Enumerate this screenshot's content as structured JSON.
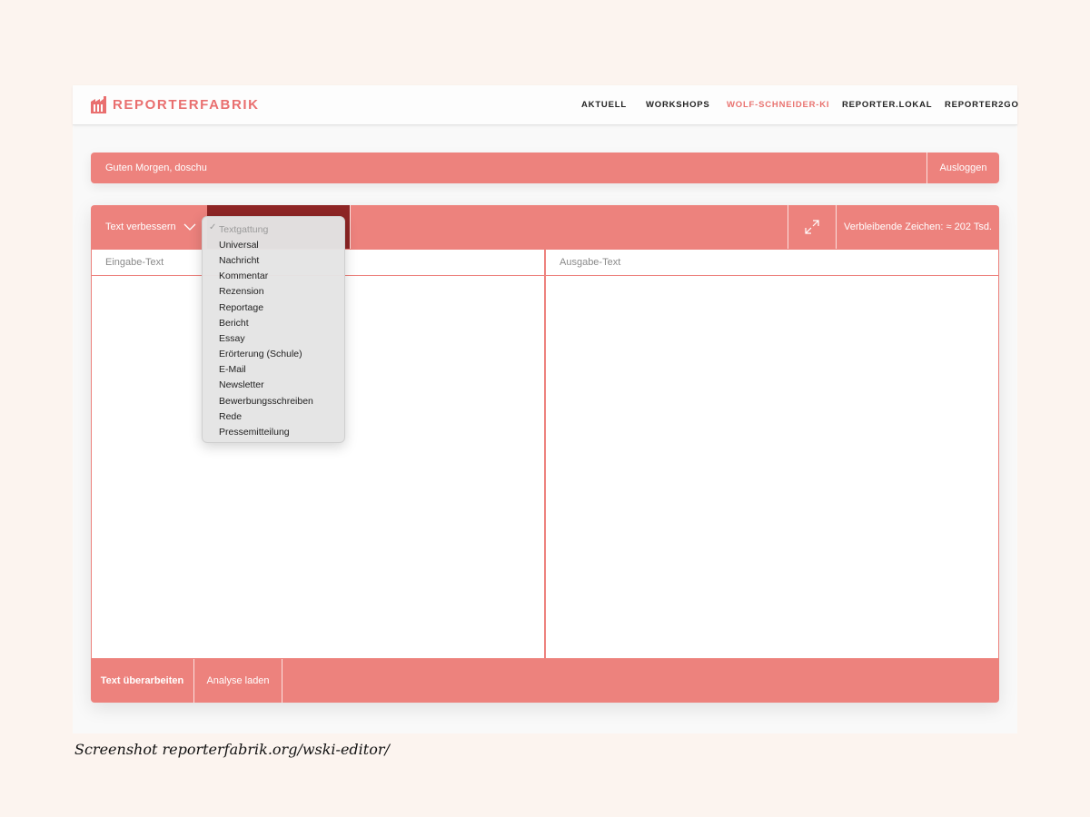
{
  "nav": {
    "logo_text": "REPORTERFABRIK",
    "links": [
      {
        "label": "AKTUELL"
      },
      {
        "label": "WORKSHOPS"
      },
      {
        "label": "WOLF-SCHNEIDER-KI",
        "active": true
      },
      {
        "label": "REPORTER.LOKAL"
      },
      {
        "label": "REPORTER2GO"
      }
    ]
  },
  "greeting_bar": {
    "greeting": "Guten Morgen, doschu",
    "logout_label": "Ausloggen"
  },
  "toolbar": {
    "mode_label": "Text verbessern",
    "char_count": "Verbleibende Zeichen: ≈ 202 Tsd."
  },
  "panes": {
    "input_header": "Eingabe-Text",
    "output_header": "Ausgabe-Text"
  },
  "bottom": {
    "submit_label": "Text überarbeiten",
    "load_label": "Analyse laden"
  },
  "dropdown": {
    "placeholder": "Textgattung",
    "options": [
      "Universal",
      "Nachricht",
      "Kommentar",
      "Rezension",
      "Reportage",
      "Bericht",
      "Essay",
      "Erörterung (Schule)",
      "E-Mail",
      "Newsletter",
      "Bewerbungsschreiben",
      "Rede",
      "Pressemitteilung"
    ]
  },
  "caption": "Screenshot reporterfabrik.org/wski-editor/",
  "colors": {
    "accent": "#ed827d",
    "dark_accent": "#8e2525",
    "background": "#fcf4ef"
  }
}
